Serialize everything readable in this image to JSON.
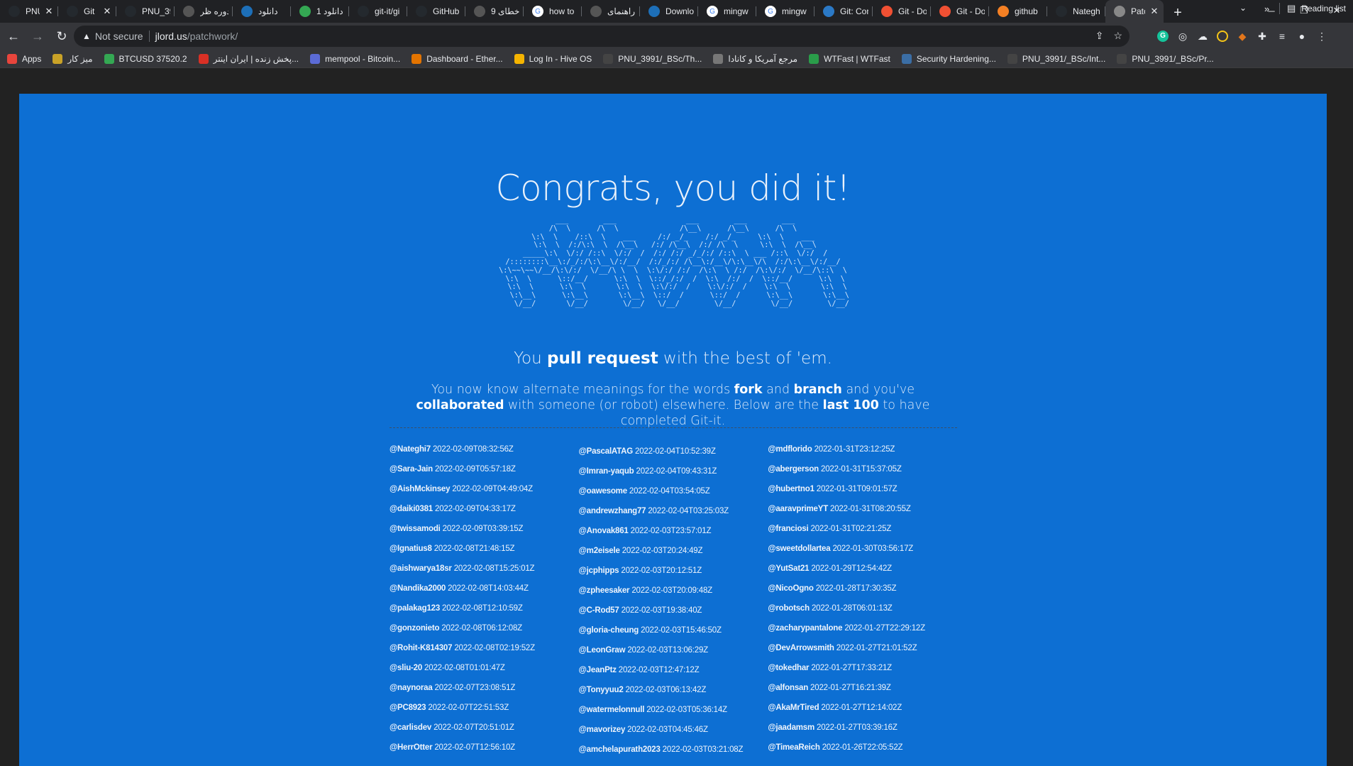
{
  "tabs": [
    {
      "title": "PNU",
      "icon": "github-icon",
      "close": "✕",
      "width": 82
    },
    {
      "title": "Git",
      "icon": "github-icon",
      "close": "✕",
      "width": 82
    },
    {
      "title": "PNU_39",
      "icon": "github-icon",
      "close": "",
      "width": 82
    },
    {
      "title": "دوره ظر",
      "icon": "web-icon",
      "close": "",
      "width": 82
    },
    {
      "title": "دانلود",
      "icon": "download-site-icon",
      "close": "",
      "width": 82
    },
    {
      "title": "دانلود 1",
      "icon": "play-icon",
      "close": "",
      "width": 82
    },
    {
      "title": "git-it/gi",
      "icon": "github-icon",
      "close": "",
      "width": 82
    },
    {
      "title": "GitHub",
      "icon": "github-icon",
      "close": "",
      "width": 82
    },
    {
      "title": "خطای 9",
      "icon": "web-icon",
      "close": "",
      "width": 82
    },
    {
      "title": "how to",
      "icon": "google-icon",
      "close": "",
      "width": 82
    },
    {
      "title": "راهنمای",
      "icon": "web-icon",
      "close": "",
      "width": 82
    },
    {
      "title": "Downlo",
      "icon": "download-site-icon",
      "close": "",
      "width": 82
    },
    {
      "title": "mingw",
      "icon": "google-icon",
      "close": "",
      "width": 82
    },
    {
      "title": "mingw",
      "icon": "google-icon",
      "close": "",
      "width": 82
    },
    {
      "title": "Git: Con",
      "icon": "vscode-icon",
      "close": "",
      "width": 82
    },
    {
      "title": "Git - Do",
      "icon": "git-icon",
      "close": "",
      "width": 82
    },
    {
      "title": "Git - Do",
      "icon": "git-icon",
      "close": "",
      "width": 82
    },
    {
      "title": "github",
      "icon": "stackoverflow-icon",
      "close": "",
      "width": 82
    },
    {
      "title": "Nategh",
      "icon": "github-icon",
      "close": "",
      "width": 82
    },
    {
      "title": "Patc",
      "icon": "globe-icon",
      "close": "✕",
      "active": true,
      "width": 82
    }
  ],
  "omnibox": {
    "security": "Not secure",
    "host": "jlord.us",
    "path": "/patchwork/"
  },
  "bookmarks": [
    {
      "label": "Apps",
      "icon": "apps-icon",
      "color": "#e8453c"
    },
    {
      "label": "میز کار",
      "icon": "coin-icon",
      "color": "#c9a227"
    },
    {
      "label": "BTCUSD 37520.2",
      "icon": "chart-up-icon",
      "color": "#34a853"
    },
    {
      "label": "پخش زنده | ایران اینتر...",
      "icon": "flag-icon",
      "color": "#d93025"
    },
    {
      "label": "mempool - Bitcoin...",
      "icon": "mempool-icon",
      "color": "#5b6bd6"
    },
    {
      "label": "Dashboard - Ether...",
      "icon": "pickaxe-icon",
      "color": "#e37400"
    },
    {
      "label": "Log In - Hive OS",
      "icon": "hive-icon",
      "color": "#f5b400"
    },
    {
      "label": "PNU_3991/_BSc/Th...",
      "icon": "github-icon",
      "color": "#444"
    },
    {
      "label": "مرجع آمریکا و کانادا",
      "icon": "shield-icon",
      "color": "#777"
    },
    {
      "label": "WTFast | WTFast",
      "icon": "check-icon",
      "color": "#2a9d4a"
    },
    {
      "label": "Security Hardening...",
      "icon": "wordpress-icon",
      "color": "#3b6ea5"
    },
    {
      "label": "PNU_3991/_BSc/Int...",
      "icon": "github-icon",
      "color": "#444"
    },
    {
      "label": "PNU_3991/_BSc/Pr...",
      "icon": "github-icon",
      "color": "#444"
    }
  ],
  "reading_list": "Reading list",
  "page": {
    "headline": "Congrats, you did it!",
    "lead_pre": "You ",
    "lead_bold": "pull request",
    "lead_post": " with the best of 'em.",
    "sub_1": "You now know alternate meanings for the words ",
    "sub_fork": "fork",
    "sub_and": " and ",
    "sub_branch": "branch",
    "sub_2": " and you've ",
    "sub_collab": "collaborated",
    "sub_3": " with someone (or robot) elsewhere. Below are the ",
    "sub_last": "last 100",
    "sub_4": " to have completed Git-it."
  },
  "completions": [
    [
      {
        "user": "@Nateghi7",
        "time": "2022-02-09T08:32:56Z"
      },
      {
        "user": "@Sara-Jain",
        "time": "2022-02-09T05:57:18Z"
      },
      {
        "user": "@AishMckinsey",
        "time": "2022-02-09T04:49:04Z"
      },
      {
        "user": "@daiki0381",
        "time": "2022-02-09T04:33:17Z"
      },
      {
        "user": "@twissamodi",
        "time": "2022-02-09T03:39:15Z"
      },
      {
        "user": "@Ignatius8",
        "time": "2022-02-08T21:48:15Z"
      },
      {
        "user": "@aishwarya18sr",
        "time": "2022-02-08T15:25:01Z"
      },
      {
        "user": "@Nandika2000",
        "time": "2022-02-08T14:03:44Z"
      },
      {
        "user": "@palakag123",
        "time": "2022-02-08T12:10:59Z"
      },
      {
        "user": "@gonzonieto",
        "time": "2022-02-08T06:12:08Z"
      },
      {
        "user": "@Rohit-K814307",
        "time": "2022-02-08T02:19:52Z"
      },
      {
        "user": "@sliu-20",
        "time": "2022-02-08T01:01:47Z"
      },
      {
        "user": "@naynoraa",
        "time": "2022-02-07T23:08:51Z"
      },
      {
        "user": "@PC8923",
        "time": "2022-02-07T22:51:53Z"
      },
      {
        "user": "@carlisdev",
        "time": "2022-02-07T20:51:01Z"
      },
      {
        "user": "@HerrOtter",
        "time": "2022-02-07T12:56:10Z"
      }
    ],
    [
      {
        "user": "@PascalATAG",
        "time": "2022-02-04T10:52:39Z"
      },
      {
        "user": "@Imran-yaqub",
        "time": "2022-02-04T09:43:31Z"
      },
      {
        "user": "@oawesome",
        "time": "2022-02-04T03:54:05Z"
      },
      {
        "user": "@andrewzhang77",
        "time": "2022-02-04T03:25:03Z"
      },
      {
        "user": "@Anovak861",
        "time": "2022-02-03T23:57:01Z"
      },
      {
        "user": "@m2eisele",
        "time": "2022-02-03T20:24:49Z"
      },
      {
        "user": "@jcphipps",
        "time": "2022-02-03T20:12:51Z"
      },
      {
        "user": "@zpheesaker",
        "time": "2022-02-03T20:09:48Z"
      },
      {
        "user": "@C-Rod57",
        "time": "2022-02-03T19:38:40Z"
      },
      {
        "user": "@gloria-cheung",
        "time": "2022-02-03T15:46:50Z"
      },
      {
        "user": "@LeonGraw",
        "time": "2022-02-03T13:06:29Z"
      },
      {
        "user": "@JeanPtz",
        "time": "2022-02-03T12:47:12Z"
      },
      {
        "user": "@Tonyyuu2",
        "time": "2022-02-03T06:13:42Z"
      },
      {
        "user": "@watermelonnull",
        "time": "2022-02-03T05:36:14Z"
      },
      {
        "user": "@mavorizey",
        "time": "2022-02-03T04:45:46Z"
      },
      {
        "user": "@amchelapurath2023",
        "time": "2022-02-03T03:21:08Z"
      }
    ],
    [
      {
        "user": "@mdflorido",
        "time": "2022-01-31T23:12:25Z"
      },
      {
        "user": "@abergerson",
        "time": "2022-01-31T15:37:05Z"
      },
      {
        "user": "@hubertno1",
        "time": "2022-01-31T09:01:57Z"
      },
      {
        "user": "@aaravprimeYT",
        "time": "2022-01-31T08:20:55Z"
      },
      {
        "user": "@franciosi",
        "time": "2022-01-31T02:21:25Z"
      },
      {
        "user": "@sweetdollartea",
        "time": "2022-01-30T03:56:17Z"
      },
      {
        "user": "@YutSat21",
        "time": "2022-01-29T12:54:42Z"
      },
      {
        "user": "@NicoOgno",
        "time": "2022-01-28T17:30:35Z"
      },
      {
        "user": "@robotsch",
        "time": "2022-01-28T06:01:13Z"
      },
      {
        "user": "@zacharypantalone",
        "time": "2022-01-27T22:29:12Z"
      },
      {
        "user": "@DevArrowsmith",
        "time": "2022-01-27T21:01:52Z"
      },
      {
        "user": "@tokedhar",
        "time": "2022-01-27T17:33:21Z"
      },
      {
        "user": "@alfonsan",
        "time": "2022-01-27T16:21:39Z"
      },
      {
        "user": "@AkaMrTired",
        "time": "2022-01-27T12:14:02Z"
      },
      {
        "user": "@jaadamsm",
        "time": "2022-01-27T03:39:16Z"
      },
      {
        "user": "@TimeaReich",
        "time": "2022-01-26T22:05:52Z"
      }
    ]
  ]
}
